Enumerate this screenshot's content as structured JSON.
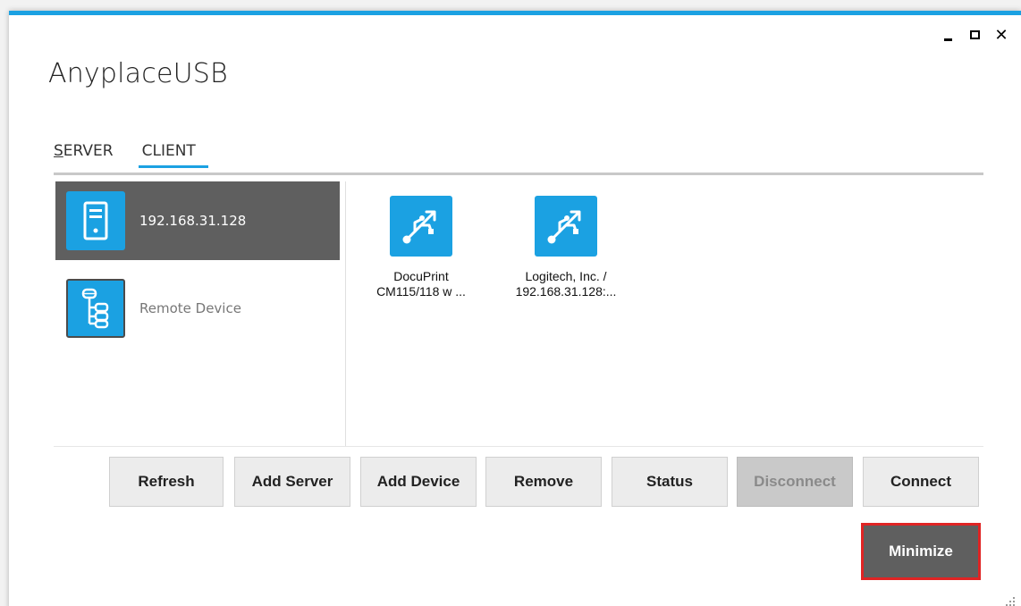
{
  "app": {
    "title": "AnyplaceUSB",
    "accent_color": "#1ba1e2"
  },
  "window_controls": {
    "minimize_icon": "minimize-icon",
    "maximize_icon": "maximize-icon",
    "close_glyph": "✕"
  },
  "tabs": [
    {
      "label_first": "S",
      "label_rest": "ERVER",
      "active": false
    },
    {
      "label": "CLIENT",
      "active": true
    }
  ],
  "servers": [
    {
      "label": "192.168.31.128",
      "icon": "server-tower-icon",
      "selected": true
    },
    {
      "label": "Remote Device",
      "icon": "device-tree-icon",
      "selected": false
    }
  ],
  "devices": [
    {
      "label": "DocuPrint\nCM115/118 w ...",
      "icon": "usb-icon"
    },
    {
      "label": "Logitech, Inc. /\n192.168.31.128:...",
      "icon": "usb-icon"
    }
  ],
  "buttons": {
    "refresh": "Refresh",
    "add_server": "Add Server",
    "add_device": "Add Device",
    "remove": "Remove",
    "status": "Status",
    "disconnect": "Disconnect",
    "connect": "Connect",
    "minimize": "Minimize"
  }
}
